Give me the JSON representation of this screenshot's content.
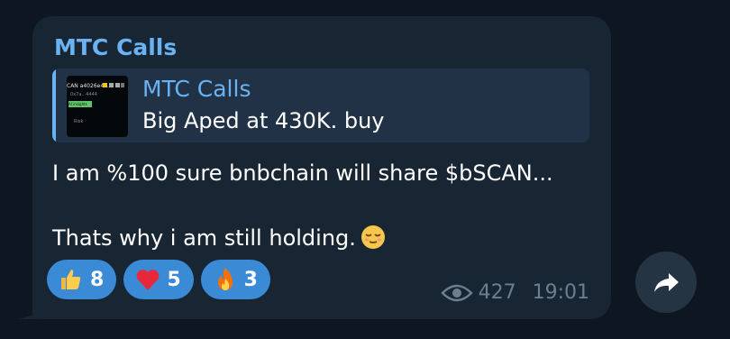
{
  "message": {
    "sender": "MTC Calls",
    "reply": {
      "title": "MTC Calls",
      "text": "Big Aped at 430K.  buy",
      "thumbnail_text": {
        "line1": "CAN a4026e4...",
        "line2": "0x7a...4444",
        "badge": "AI insights",
        "footer": "Risk"
      }
    },
    "text_line1": "I am %100 sure bnbchain will share $bSCAN...",
    "text_line2": "Thats why i am still holding.",
    "inline_emoji": "relieved-face-emoji",
    "reactions": [
      {
        "emoji": "thumbs-up",
        "count": "8"
      },
      {
        "emoji": "red-heart",
        "count": "5"
      },
      {
        "emoji": "fire",
        "count": "3"
      }
    ],
    "views": "427",
    "time": "19:01"
  },
  "colors": {
    "background": "#0e1621",
    "bubble": "#182533",
    "accent": "#6ab3f3",
    "reaction_bg": "#3a8ad6",
    "meta": "#6d7f8f"
  }
}
